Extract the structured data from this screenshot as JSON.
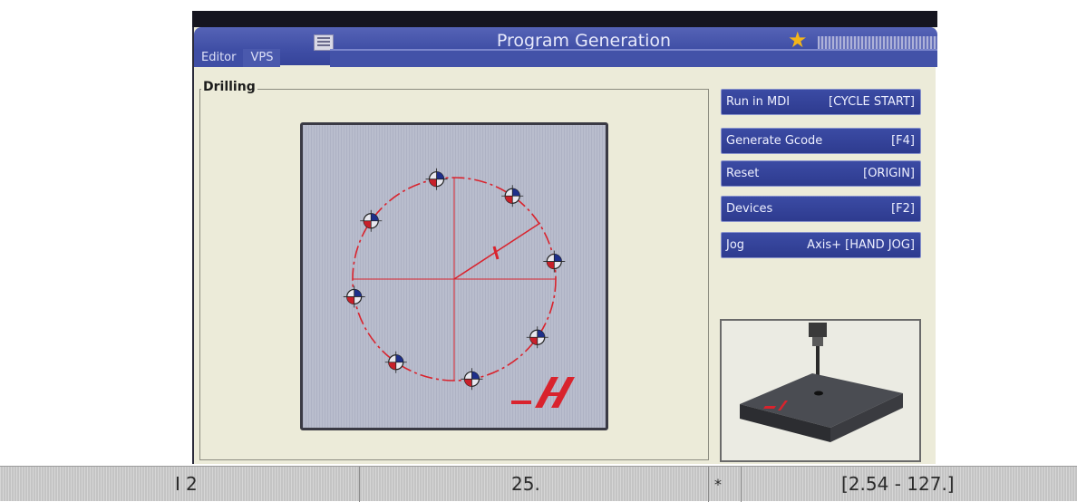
{
  "header": {
    "title": "Program Generation",
    "tabs": [
      {
        "label": "Editor"
      },
      {
        "label": "VPS"
      }
    ]
  },
  "panel": {
    "label": "Drilling"
  },
  "buttons": [
    {
      "label": "Run in MDI",
      "key": "[CYCLE START]"
    },
    {
      "label": "Generate Gcode",
      "key": "[F4]"
    },
    {
      "label": "Reset",
      "key": "[ORIGIN]"
    },
    {
      "label": "Devices",
      "key": "[F2]"
    },
    {
      "label": "Jog",
      "key": "Axis+ [HAND JOG]"
    }
  ],
  "graphic": {
    "diagram_letter": "I"
  },
  "status": {
    "variable": "I",
    "input_value": "2",
    "value": "25.",
    "marker": "*",
    "range": "[2.54 - 127.]"
  },
  "colors": {
    "accent": "#3f4ea5",
    "highlight": "#d9232d",
    "background": "#ecebd9"
  }
}
